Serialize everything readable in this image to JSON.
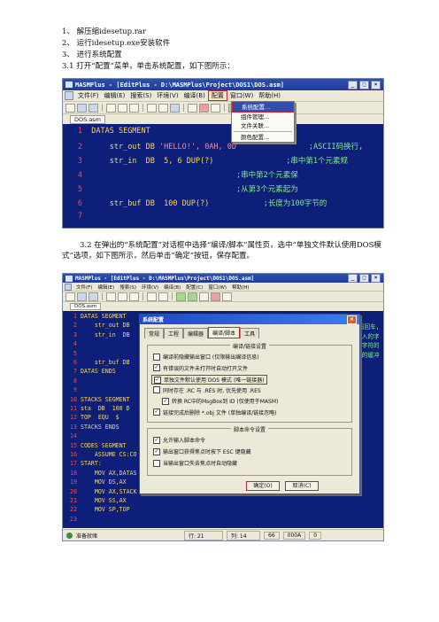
{
  "doc": {
    "steps": [
      "1、 解压缩idesetup.rar",
      "2、 运行idesetup.exe安装软件",
      "3、 进行系统配置"
    ],
    "step31": "3.1 打开“配置”菜单，单击系统配置，如下图所示：",
    "step32": "3.2 在弹出的“系统配置”对话框中选择“编译/脚本”属性页，选中“单独文件默认使用DOS模式”选项，如下图所示，然后单击“确定”按钮，保存配置。"
  },
  "shot1": {
    "title": "MASMPlus - [EditPlus - D:\\MASMPlus\\Project\\DOS1\\DOS.asm]",
    "menu": [
      "文件(F)",
      "编辑(E)",
      "搜索(S)",
      "环境(V)",
      "编译(B)",
      "配置",
      "窗口(W)",
      "帮助(H)"
    ],
    "tab": "DOS.asm",
    "dropdown": [
      "系统配置...",
      "组件管理...",
      "文件关联...",
      "颜色配置..."
    ],
    "code": [
      {
        "n": "1",
        "a": "DATAS SEGMENT",
        "b": "",
        "c": ""
      },
      {
        "n": "2",
        "a": "    str_out DB ",
        "b": "'HELLO!', 0AH, 0D",
        "c": "                ;ASCII码换行,"
      },
      {
        "n": "3",
        "a": "    str_in  DB  5, 6 DUP(?)",
        "b": "",
        "c": "                ;串中第1个元素规"
      },
      {
        "n": "4",
        "a": "",
        "b": "",
        "c": "                                ;串中第2个元素保"
      },
      {
        "n": "5",
        "a": "",
        "b": "",
        "c": "                                ;从第3个元素起为"
      },
      {
        "n": "6",
        "a": "    str_buf DB  100 DUP(?)",
        "b": "",
        "c": "            ;长度为100字节的"
      },
      {
        "n": "7",
        "a": "",
        "b": "",
        "c": ""
      }
    ]
  },
  "shot2": {
    "title": "MASMPlus - [EditPlus - D:\\MASMPlus\\Project\\DOS1\\DOS.asm]",
    "menu": [
      "文件(F)",
      "编辑(E)",
      "搜索(S)",
      "环境(V)",
      "编译(B)",
      "配置(C)",
      "窗口(W)",
      "帮助(H)"
    ],
    "tab": "DOS.asm",
    "code": [
      {
        "n": "1",
        "a": "DATAS SEGMENT",
        "c": ""
      },
      {
        "n": "2",
        "a": "    str_out DB",
        "c": "SCII码回车,"
      },
      {
        "n": "3",
        "a": "    str_in  DB",
        "c": "最多输入的字"
      },
      {
        "n": "4",
        "a": "",
        "c": "存输入字符的"
      },
      {
        "n": "5",
        "a": "",
        "c": "存字符的缓冲"
      },
      {
        "n": "6",
        "a": "    str_buf DB",
        "c": "缓冲区"
      },
      {
        "n": "7",
        "a": "DATAS ENDS",
        "c": ""
      },
      {
        "n": "8",
        "a": "",
        "c": ""
      },
      {
        "n": "9",
        "a": "",
        "c": ""
      },
      {
        "n": "10",
        "a": "STACKS SEGMENT",
        "c": ""
      },
      {
        "n": "11",
        "a": "sta  DB  100 D",
        "c": ""
      },
      {
        "n": "12",
        "a": "TOP  EQU  $",
        "c": ""
      },
      {
        "n": "13",
        "a": "STACKS ENDS",
        "c": ""
      },
      {
        "n": "14",
        "a": "",
        "c": ""
      },
      {
        "n": "15",
        "a": "CODES SEGMENT",
        "c": ""
      },
      {
        "n": "16",
        "a": "    ASSUME CS:CO",
        "c": ""
      },
      {
        "n": "17",
        "a": "START:",
        "c": ""
      },
      {
        "n": "18",
        "a": "    MOV AX,DATAS",
        "c": ""
      },
      {
        "n": "19",
        "a": "    MOV DS,AX",
        "c": ""
      },
      {
        "n": "20",
        "a": "    MOV AX,STACK",
        "c": ""
      },
      {
        "n": "21",
        "a": "    MOV SS,AX",
        "c": ""
      },
      {
        "n": "22",
        "a": "    MOV SP,TOP",
        "c": ""
      },
      {
        "n": "23",
        "a": "",
        "c": ""
      }
    ],
    "status": [
      "准备就绪",
      "行: 21",
      "列: 14",
      "66",
      "000A",
      "0"
    ],
    "dialog": {
      "title": "系统配置",
      "tabs": [
        "常规",
        "工程",
        "编辑器",
        "编译/脚本",
        "工具"
      ],
      "group1": "编译/链接设置",
      "opts1": [
        {
          "label": "编译前隐藏输出窗口 (仅限输出编译信息)",
          "checked": false
        },
        {
          "label": "有错误的文件未打开时自动打开文件",
          "checked": true
        },
        {
          "label": "单独文件默认使用 DOS 模式 (唯一链接器)",
          "checked": true
        },
        {
          "label": "同时存在 .RC 与 .RES 时, 优先使用 .RES",
          "checked": false
        },
        {
          "label": "转换 RC中的MsgBox到 ID (仅使用于MASM)",
          "checked": true
        },
        {
          "label": "链接完成后删除 *.obj 文件 (单独编译/链接忽略)",
          "checked": true
        }
      ],
      "group2": "脚本命令设置",
      "opts2": [
        {
          "label": "允许输入脚本命令",
          "checked": true
        },
        {
          "label": "输出窗口获得焦点时按下 ESC 键隐藏",
          "checked": true
        },
        {
          "label": "当输出窗口失去焦点时自动隐藏",
          "checked": false
        }
      ],
      "ok": "确定(O)",
      "cancel": "取消(C)"
    }
  }
}
